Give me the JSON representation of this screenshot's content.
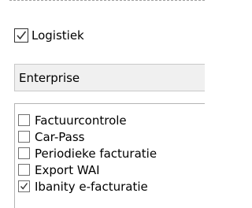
{
  "logistiek": {
    "label": "Logistiek",
    "checked": true
  },
  "enterprise_field": {
    "value": "Enterprise"
  },
  "options": [
    {
      "label": "Factuurcontrole",
      "checked": false
    },
    {
      "label": "Car-Pass",
      "checked": false
    },
    {
      "label": "Periodieke facturatie",
      "checked": false
    },
    {
      "label": "Export WAI",
      "checked": false
    },
    {
      "label": "Ibanity e-facturatie",
      "checked": true
    }
  ],
  "icons": {
    "checked_mark": "checkmark-icon"
  },
  "colors": {
    "field_background": "#f0f0f0",
    "checkbox_border": "#707070",
    "check_color": "#333333"
  }
}
